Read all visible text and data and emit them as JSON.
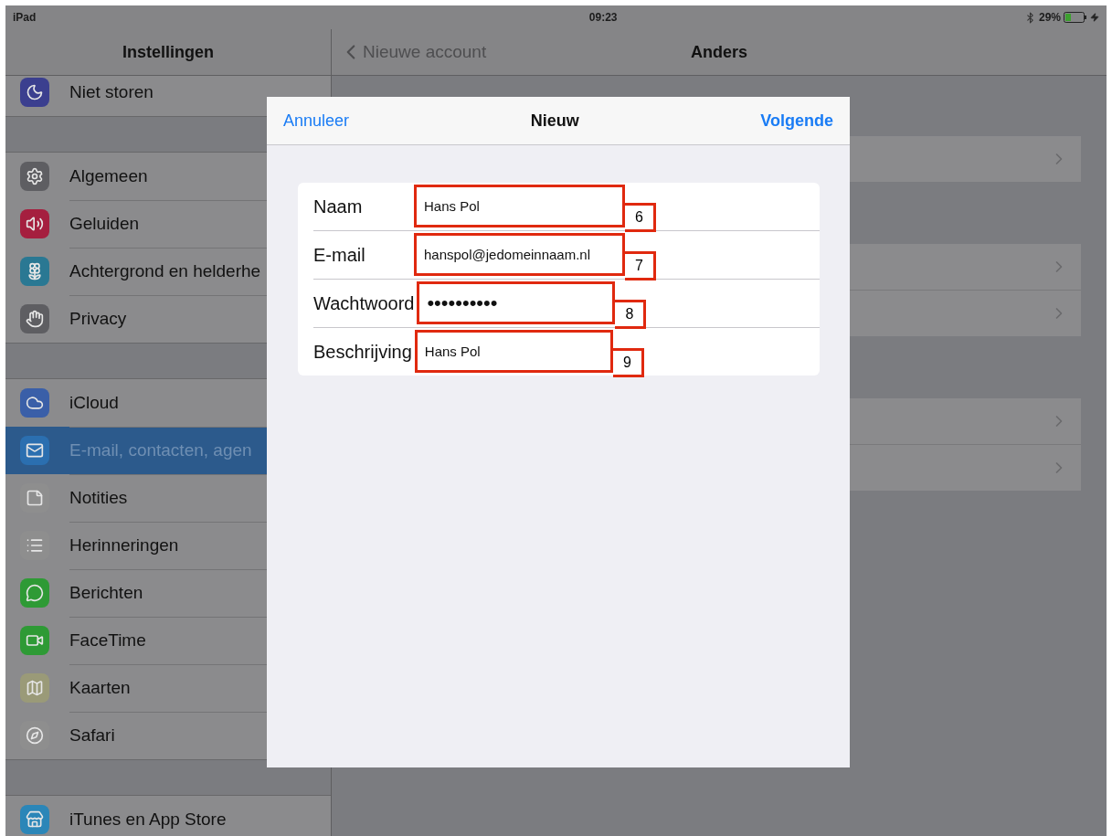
{
  "status_bar": {
    "device": "iPad",
    "time": "09:23",
    "battery": "29%"
  },
  "sidebar": {
    "title": "Instellingen",
    "groups": [
      {
        "items": [
          {
            "label": "Niet storen",
            "color": "#3b3f8f",
            "selected": false
          }
        ]
      },
      {
        "items": [
          {
            "label": "Algemeen",
            "color": "#5e5e62",
            "selected": false
          },
          {
            "label": "Geluiden",
            "color": "#a51f3f",
            "selected": false
          },
          {
            "label": "Achtergrond en helderhe",
            "color": "#2a7893",
            "selected": false
          },
          {
            "label": "Privacy",
            "color": "#5e5e62",
            "selected": false
          }
        ]
      },
      {
        "items": [
          {
            "label": "iCloud",
            "color": "#3a5fa8",
            "selected": false
          },
          {
            "label": "E-mail, contacten, agen",
            "color": "#2b6fb0",
            "selected": true
          },
          {
            "label": "Notities",
            "color": "#8e8e8e",
            "selected": false
          },
          {
            "label": "Herinneringen",
            "color": "#8e8e8e",
            "selected": false
          },
          {
            "label": "Berichten",
            "color": "#2e9a35",
            "selected": false
          },
          {
            "label": "FaceTime",
            "color": "#2e9a35",
            "selected": false
          },
          {
            "label": "Kaarten",
            "color": "#9a9a78",
            "selected": false
          },
          {
            "label": "Safari",
            "color": "#8e8e8e",
            "selected": false
          }
        ]
      },
      {
        "items": [
          {
            "label": "iTunes en App Store",
            "color": "#2b86b8",
            "selected": false
          }
        ]
      }
    ]
  },
  "detail": {
    "back": "Nieuwe account",
    "title": "Anders",
    "groups": [
      {
        "rows": [
          {
            "chevron": true
          }
        ]
      },
      {
        "rows": [
          {
            "chevron": true
          },
          {
            "chevron": true
          }
        ]
      },
      {
        "rows": [
          {
            "chevron": true
          },
          {
            "chevron": true
          }
        ]
      }
    ]
  },
  "dialog": {
    "cancel": "Annuleer",
    "title": "Nieuw",
    "next": "Volgende",
    "fields": [
      {
        "label": "Naam",
        "value": "Hans Pol",
        "kind": "text",
        "callout": "6"
      },
      {
        "label": "E-mail",
        "value": "hanspol@jedomeinnaam.nl",
        "kind": "text",
        "callout": "7"
      },
      {
        "label": "Wachtwoord",
        "value": "••••••••••",
        "kind": "password",
        "callout": "8"
      },
      {
        "label": "Beschrijving",
        "value": "Hans Pol",
        "kind": "text",
        "callout": "9"
      }
    ]
  }
}
